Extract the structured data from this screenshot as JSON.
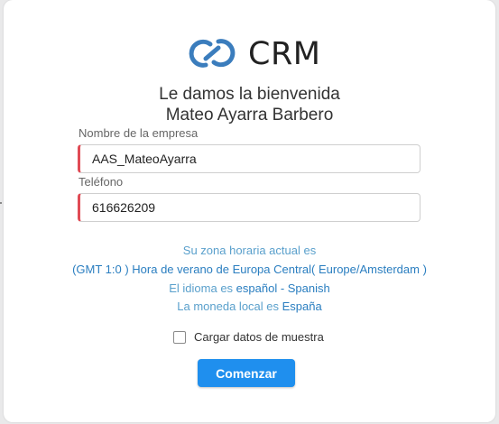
{
  "logo": {
    "text": "CRM",
    "icon": "crm-rings-icon",
    "color": "#3b7dbd"
  },
  "welcome": {
    "line1": "Le damos la bienvenida",
    "line2": "Mateo Ayarra Barbero"
  },
  "company": {
    "label": "Nombre de la empresa",
    "value": "AAS_MateoAyarra"
  },
  "phone": {
    "label": "Teléfono",
    "value": "616626209"
  },
  "timezone": {
    "intro": "Su zona horaria actual es",
    "value": "(GMT 1:0 ) Hora de verano de Europa Central( Europe/Amsterdam )"
  },
  "language": {
    "prefix": "El idioma es",
    "value": "español - Spanish"
  },
  "currency": {
    "prefix": "La moneda local es",
    "value": "España"
  },
  "sample_data": {
    "label": "Cargar datos de muestra",
    "checked": false
  },
  "submit": {
    "label": "Comenzar",
    "color": "#1f8fee"
  },
  "colors": {
    "required_marker": "#e04b55",
    "info_text": "#5aa0cc",
    "link_text": "#2a7ec0"
  }
}
